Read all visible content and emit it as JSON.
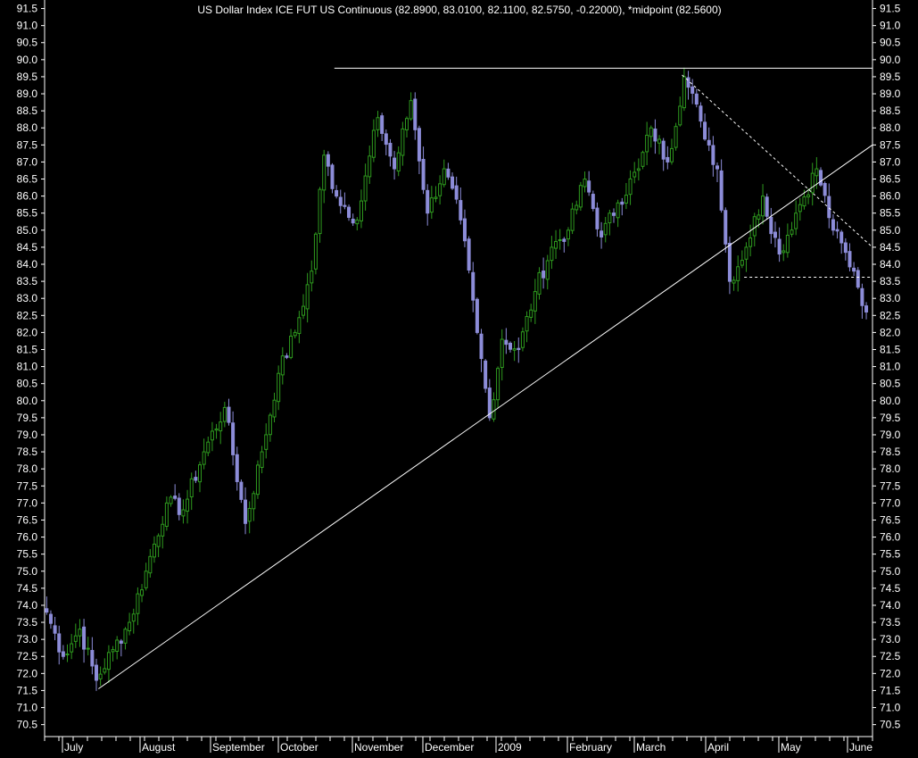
{
  "chart_data": {
    "type": "candlestick",
    "title": "US Dollar Index ICE FUT US Continuous (82.8900, 83.0100, 82.1100, 82.5750, -0.22000), *midpoint (82.5600)",
    "y_ticks": [
      "91.5",
      "91.0",
      "90.5",
      "90.0",
      "89.5",
      "89.0",
      "88.5",
      "88.0",
      "87.5",
      "87.0",
      "86.5",
      "86.0",
      "85.5",
      "85.0",
      "84.5",
      "84.0",
      "83.5",
      "83.0",
      "82.5",
      "82.0",
      "81.5",
      "81.0",
      "80.5",
      "80.0",
      "79.5",
      "79.0",
      "78.5",
      "78.0",
      "77.5",
      "77.0",
      "76.5",
      "76.0",
      "75.5",
      "75.0",
      "74.5",
      "74.0",
      "73.5",
      "73.0",
      "72.5",
      "72.0",
      "71.5",
      "71.0",
      "70.5"
    ],
    "x_labels": [
      "July",
      "August",
      "September",
      "October",
      "November",
      "December",
      "2009",
      "February",
      "March",
      "April",
      "May",
      "June"
    ],
    "ylim": [
      70.15,
      91.75
    ],
    "colors": {
      "up": "#2e9a1e",
      "down": "#8c8cd8",
      "line": "#ffffff",
      "axis": "#ffffff",
      "grid": "none",
      "background": "#000000"
    },
    "anchors": [
      {
        "t": 0,
        "v": 73.8
      },
      {
        "t": 4,
        "v": 72.5
      },
      {
        "t": 8,
        "v": 73.3
      },
      {
        "t": 12,
        "v": 71.8
      },
      {
        "t": 16,
        "v": 72.7
      },
      {
        "t": 20,
        "v": 73.5
      },
      {
        "t": 24,
        "v": 75.0
      },
      {
        "t": 29,
        "v": 77.0
      },
      {
        "t": 33,
        "v": 76.8
      },
      {
        "t": 38,
        "v": 78.5
      },
      {
        "t": 43,
        "v": 79.8
      },
      {
        "t": 48,
        "v": 76.4
      },
      {
        "t": 52,
        "v": 78.5
      },
      {
        "t": 56,
        "v": 80.8
      },
      {
        "t": 60,
        "v": 82.0
      },
      {
        "t": 64,
        "v": 83.8
      },
      {
        "t": 67,
        "v": 87.2
      },
      {
        "t": 70,
        "v": 86.0
      },
      {
        "t": 75,
        "v": 85.3
      },
      {
        "t": 80,
        "v": 88.3
      },
      {
        "t": 84,
        "v": 86.8
      },
      {
        "t": 88,
        "v": 88.8
      },
      {
        "t": 92,
        "v": 85.5
      },
      {
        "t": 96,
        "v": 86.8
      },
      {
        "t": 100,
        "v": 85.3
      },
      {
        "t": 104,
        "v": 82.0
      },
      {
        "t": 107,
        "v": 79.5
      },
      {
        "t": 110,
        "v": 81.8
      },
      {
        "t": 114,
        "v": 81.5
      },
      {
        "t": 118,
        "v": 83.2
      },
      {
        "t": 122,
        "v": 84.5
      },
      {
        "t": 126,
        "v": 85.0
      },
      {
        "t": 130,
        "v": 86.5
      },
      {
        "t": 134,
        "v": 84.8
      },
      {
        "t": 138,
        "v": 85.8
      },
      {
        "t": 143,
        "v": 86.8
      },
      {
        "t": 146,
        "v": 88.0
      },
      {
        "t": 150,
        "v": 87.0
      },
      {
        "t": 154,
        "v": 89.5
      },
      {
        "t": 158,
        "v": 88.2
      },
      {
        "t": 162,
        "v": 86.8
      },
      {
        "t": 165,
        "v": 83.5
      },
      {
        "t": 169,
        "v": 84.5
      },
      {
        "t": 173,
        "v": 86.0
      },
      {
        "t": 177,
        "v": 84.3
      },
      {
        "t": 181,
        "v": 85.5
      },
      {
        "t": 186,
        "v": 86.8
      },
      {
        "t": 190,
        "v": 85.0
      },
      {
        "t": 195,
        "v": 83.8
      },
      {
        "t": 198,
        "v": 82.6
      }
    ],
    "lines": [
      {
        "name": "trendline",
        "kind": "solid",
        "from": {
          "t": 13,
          "v": 71.55
        },
        "to": {
          "t": 200,
          "v": 87.5
        }
      },
      {
        "name": "resistance",
        "kind": "solid",
        "from": {
          "t": 70,
          "v": 89.75
        },
        "to": {
          "t": 200,
          "v": 89.75
        }
      },
      {
        "name": "downtrend",
        "kind": "dashed",
        "from": {
          "t": 154,
          "v": 89.55
        },
        "to": {
          "t": 200,
          "v": 84.5
        }
      },
      {
        "name": "support",
        "kind": "dashed",
        "from": {
          "t": 169,
          "v": 83.62
        },
        "to": {
          "t": 200,
          "v": 83.62
        }
      }
    ]
  }
}
